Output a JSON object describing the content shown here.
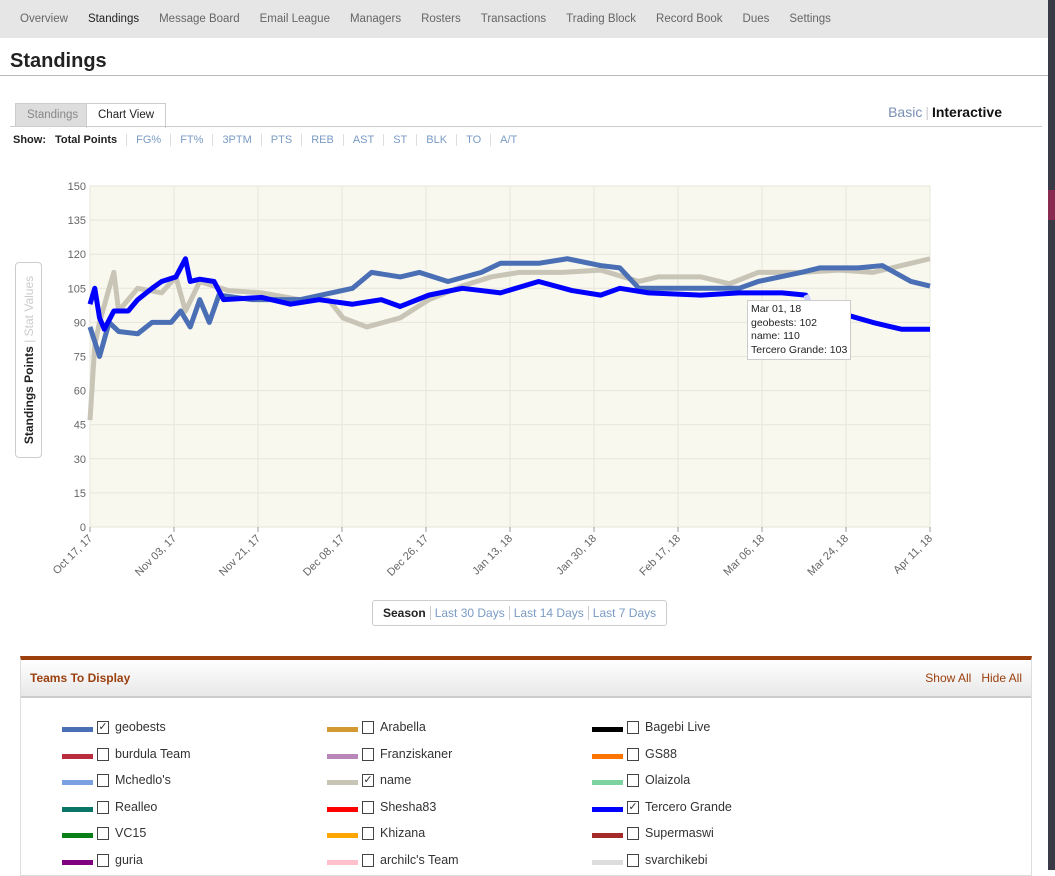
{
  "nav": [
    "Overview",
    "Standings",
    "Message Board",
    "Email League",
    "Managers",
    "Rosters",
    "Transactions",
    "Trading Block",
    "Record Book",
    "Dues",
    "Settings"
  ],
  "nav_active": 1,
  "page_title": "Standings",
  "tabs": [
    "Standings",
    "Chart View"
  ],
  "mode": {
    "basic": "Basic",
    "interactive": "Interactive"
  },
  "show": {
    "label": "Show:",
    "items": [
      "Total Points",
      "FG%",
      "FT%",
      "3PTM",
      "PTS",
      "REB",
      "AST",
      "ST",
      "BLK",
      "TO",
      "A/T"
    ]
  },
  "y_toggle": {
    "active": "Standings Points",
    "inactive": "Stat Values"
  },
  "range": [
    "Season",
    "Last 30 Days",
    "Last 14 Days",
    "Last 7 Days"
  ],
  "tooltip": [
    "Mar 01, 18",
    "geobests: 102",
    "name: 110",
    "Tercero Grande: 103"
  ],
  "chart_data": {
    "type": "line",
    "ylabel": "Standings Points",
    "ylim": [
      0,
      150
    ],
    "yticks": [
      0,
      15,
      30,
      45,
      60,
      75,
      90,
      105,
      120,
      135,
      150
    ],
    "x_unit": "days since Oct 17, 17",
    "xlim": [
      0,
      176
    ],
    "xticks": [
      "Oct 17, 17",
      "Nov 03, 17",
      "Nov 21, 17",
      "Dec 08, 17",
      "Dec 26, 17",
      "Jan 13, 18",
      "Jan 30, 18",
      "Feb 17, 18",
      "Mar 06, 18",
      "Mar 24, 18",
      "Apr 11, 18"
    ],
    "series": [
      {
        "name": "name",
        "color": "#c8c5b7",
        "points": [
          [
            0,
            47
          ],
          [
            1,
            80
          ],
          [
            2,
            90
          ],
          [
            4,
            105
          ],
          [
            5,
            112
          ],
          [
            6,
            95
          ],
          [
            10,
            105
          ],
          [
            15,
            103
          ],
          [
            18,
            110
          ],
          [
            20,
            95
          ],
          [
            23,
            108
          ],
          [
            29,
            104
          ],
          [
            36,
            103
          ],
          [
            44,
            100
          ],
          [
            50,
            100
          ],
          [
            53,
            92
          ],
          [
            58,
            88
          ],
          [
            65,
            92
          ],
          [
            71,
            100
          ],
          [
            78,
            106
          ],
          [
            84,
            110
          ],
          [
            90,
            112
          ],
          [
            99,
            112
          ],
          [
            107,
            113
          ],
          [
            115,
            108
          ],
          [
            119,
            110
          ],
          [
            128,
            110
          ],
          [
            134,
            107
          ],
          [
            140,
            112
          ],
          [
            149,
            112
          ],
          [
            157,
            113
          ],
          [
            164,
            112
          ],
          [
            170,
            115
          ],
          [
            176,
            118
          ]
        ]
      },
      {
        "name": "geobests",
        "color": "#4a6fb5",
        "points": [
          [
            0,
            88
          ],
          [
            2,
            75
          ],
          [
            4,
            90
          ],
          [
            6,
            86
          ],
          [
            10,
            85
          ],
          [
            13,
            90
          ],
          [
            17,
            90
          ],
          [
            19,
            95
          ],
          [
            21,
            88
          ],
          [
            23,
            100
          ],
          [
            25,
            90
          ],
          [
            27,
            102
          ],
          [
            34,
            100
          ],
          [
            44,
            100
          ],
          [
            55,
            105
          ],
          [
            59,
            112
          ],
          [
            65,
            110
          ],
          [
            69,
            112
          ],
          [
            75,
            108
          ],
          [
            82,
            112
          ],
          [
            86,
            116
          ],
          [
            94,
            116
          ],
          [
            100,
            118
          ],
          [
            107,
            115
          ],
          [
            111,
            114
          ],
          [
            115,
            105
          ],
          [
            128,
            105
          ],
          [
            136,
            105
          ],
          [
            140,
            108
          ],
          [
            149,
            112
          ],
          [
            153,
            114
          ],
          [
            161,
            114
          ],
          [
            166,
            115
          ],
          [
            172,
            108
          ],
          [
            176,
            106
          ]
        ]
      },
      {
        "name": "Tercero Grande",
        "color": "#0000ff",
        "points": [
          [
            0,
            98
          ],
          [
            1,
            105
          ],
          [
            2,
            92
          ],
          [
            3,
            87
          ],
          [
            5,
            95
          ],
          [
            8,
            95
          ],
          [
            10,
            100
          ],
          [
            13,
            105
          ],
          [
            15,
            108
          ],
          [
            18,
            110
          ],
          [
            20,
            118
          ],
          [
            21,
            108
          ],
          [
            23,
            109
          ],
          [
            26,
            108
          ],
          [
            28,
            100
          ],
          [
            36,
            101
          ],
          [
            42,
            98
          ],
          [
            48,
            100
          ],
          [
            55,
            98
          ],
          [
            61,
            100
          ],
          [
            65,
            97
          ],
          [
            71,
            102
          ],
          [
            78,
            105
          ],
          [
            82,
            104
          ],
          [
            86,
            103
          ],
          [
            94,
            108
          ],
          [
            101,
            104
          ],
          [
            107,
            102
          ],
          [
            111,
            105
          ],
          [
            117,
            103
          ],
          [
            128,
            102
          ],
          [
            136,
            103
          ],
          [
            145,
            103
          ],
          [
            150,
            102
          ],
          [
            151,
            97
          ],
          [
            159,
            93
          ],
          [
            164,
            90
          ],
          [
            170,
            87
          ],
          [
            176,
            87
          ]
        ]
      }
    ]
  },
  "teams": {
    "title": "Teams To Display",
    "show_all": "Show All",
    "hide_all": "Hide All",
    "items": [
      {
        "name": "geobests",
        "color": "#4a6fb5",
        "checked": true
      },
      {
        "name": "burdula Team",
        "color": "#b82c3c",
        "checked": false
      },
      {
        "name": "Mchedlo's",
        "color": "#79a0e0",
        "checked": false
      },
      {
        "name": "Realleo",
        "color": "#0b7565",
        "checked": false
      },
      {
        "name": "VC15",
        "color": "#0a7f17",
        "checked": false
      },
      {
        "name": "guria",
        "color": "#800080",
        "checked": false
      },
      {
        "name": "Arabella",
        "color": "#d39a33",
        "checked": false
      },
      {
        "name": "Franziskaner",
        "color": "#b886b8",
        "checked": false
      },
      {
        "name": "name",
        "color": "#c8c5b7",
        "checked": true
      },
      {
        "name": "Shesha83",
        "color": "#ff0000",
        "checked": false
      },
      {
        "name": "Khizana",
        "color": "#ffa500",
        "checked": false
      },
      {
        "name": "archilc's Team",
        "color": "#ffc0cb",
        "checked": false
      },
      {
        "name": "Bagebi Live",
        "color": "#000000",
        "checked": false
      },
      {
        "name": "GS88",
        "color": "#ff7400",
        "checked": false
      },
      {
        "name": "Olaizola",
        "color": "#7dd3a0",
        "checked": false
      },
      {
        "name": "Tercero Grande",
        "color": "#0000ff",
        "checked": true
      },
      {
        "name": "Supermaswi",
        "color": "#a52a2a",
        "checked": false
      },
      {
        "name": "svarchikebi",
        "color": "#dddddd",
        "checked": false
      }
    ]
  }
}
